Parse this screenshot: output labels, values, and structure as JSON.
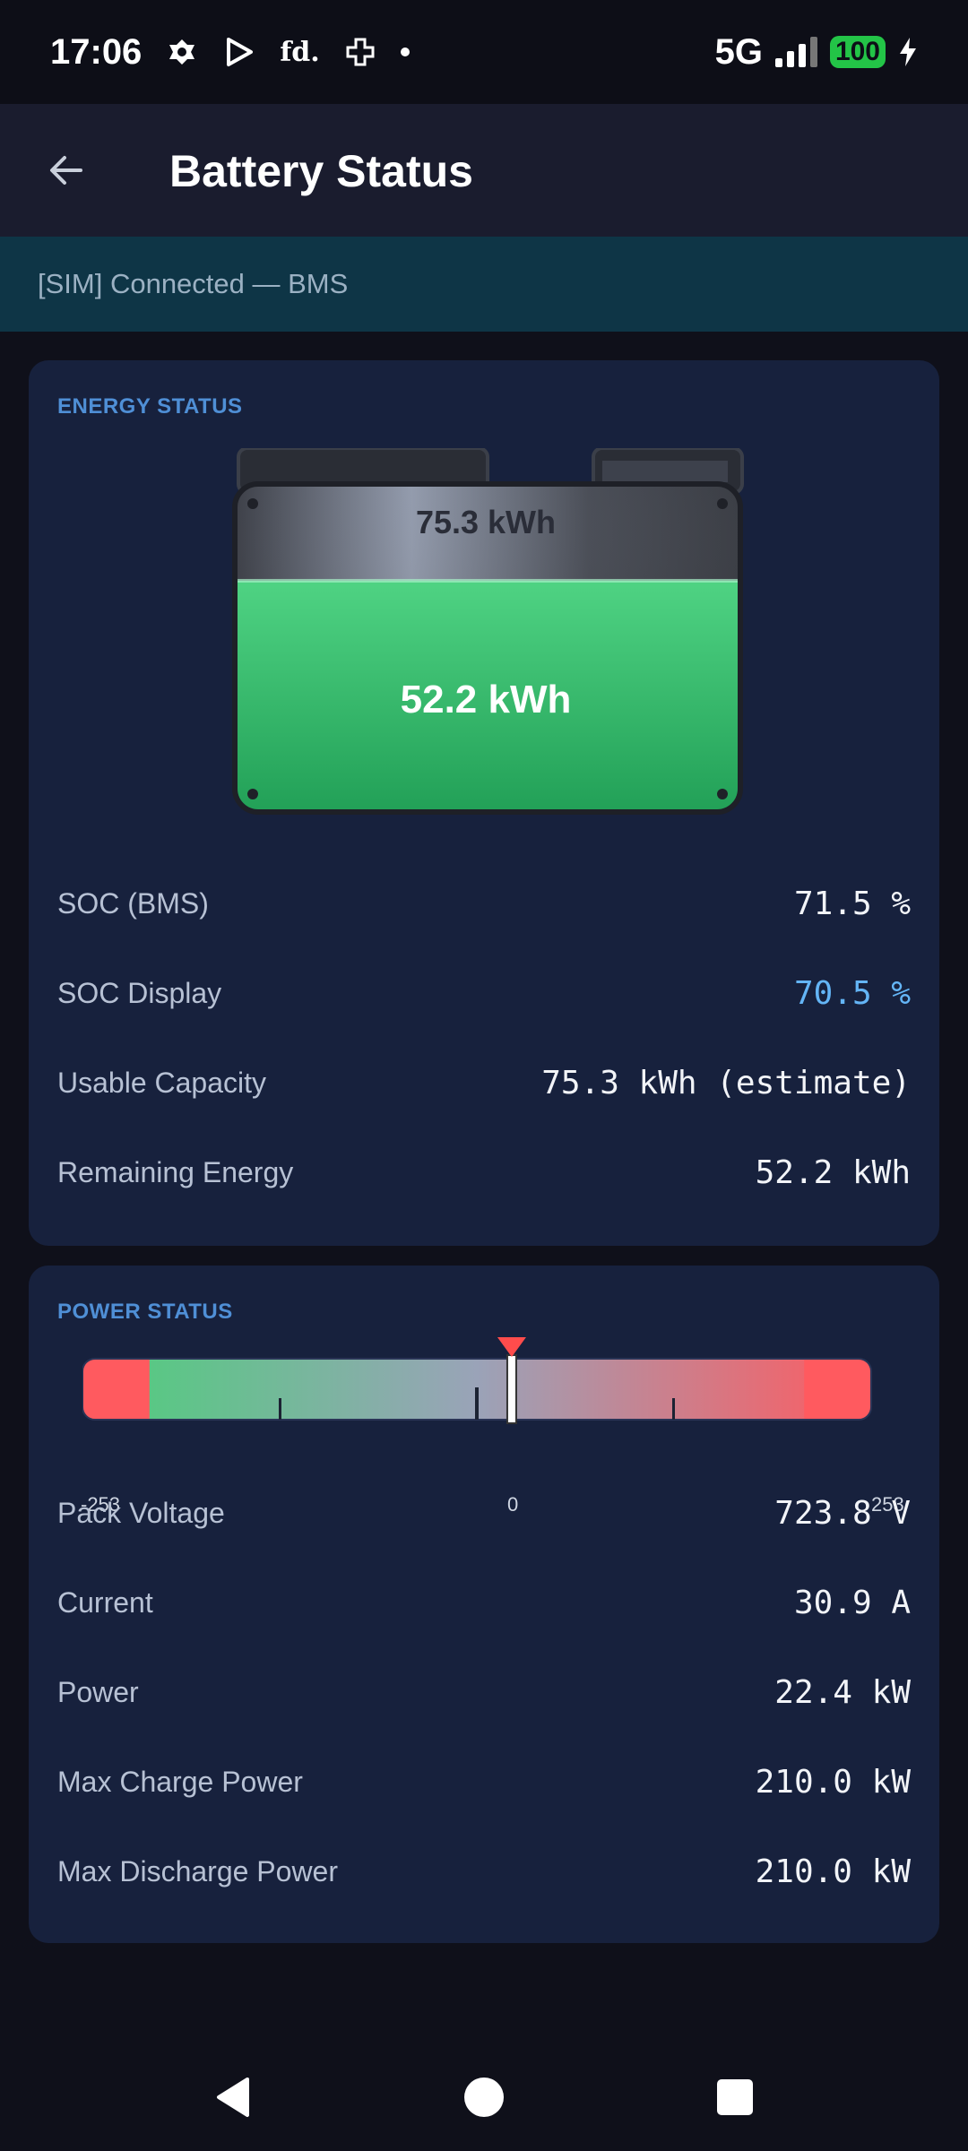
{
  "status_bar": {
    "time": "17:06",
    "fd_badge": "fd.",
    "network": "5G",
    "battery_level": "100"
  },
  "app_bar": {
    "title": "Battery Status"
  },
  "connection": {
    "text": "[SIM] Connected — BMS"
  },
  "energy": {
    "title": "ENERGY STATUS",
    "battery_total_label": "75.3 kWh",
    "battery_remaining_label": "52.2 kWh",
    "fill_fraction": 0.705,
    "rows": [
      {
        "label": "SOC (BMS)",
        "value": "71.5 %"
      },
      {
        "label": "SOC Display",
        "value": "70.5 %"
      },
      {
        "label": "Usable Capacity",
        "value": "75.3 kWh (estimate)"
      },
      {
        "label": "Remaining Energy",
        "value": "52.2 kWh"
      }
    ]
  },
  "power": {
    "title": "POWER STATUS",
    "gauge": {
      "min_label": "-253",
      "zero_label": "0",
      "max_label": "253",
      "min": -253,
      "max": 253,
      "value": 22.4,
      "limit_charge": 210.0,
      "limit_discharge": 210.0
    },
    "rows": [
      {
        "label": "Pack Voltage",
        "value": "723.8 V"
      },
      {
        "label": "Current",
        "value": "30.9 A"
      },
      {
        "label": "Power",
        "value": "22.4 kW"
      },
      {
        "label": "Max Charge Power",
        "value": "210.0 kW"
      },
      {
        "label": "Max Discharge Power",
        "value": "210.0 kW"
      }
    ]
  },
  "colors": {
    "accent_blue": "#64b5f6",
    "section_title": "#4f8fd6",
    "card_bg": "#17213d",
    "charge_green": "#4ccf7a",
    "limit_red": "#ff5a5f"
  }
}
